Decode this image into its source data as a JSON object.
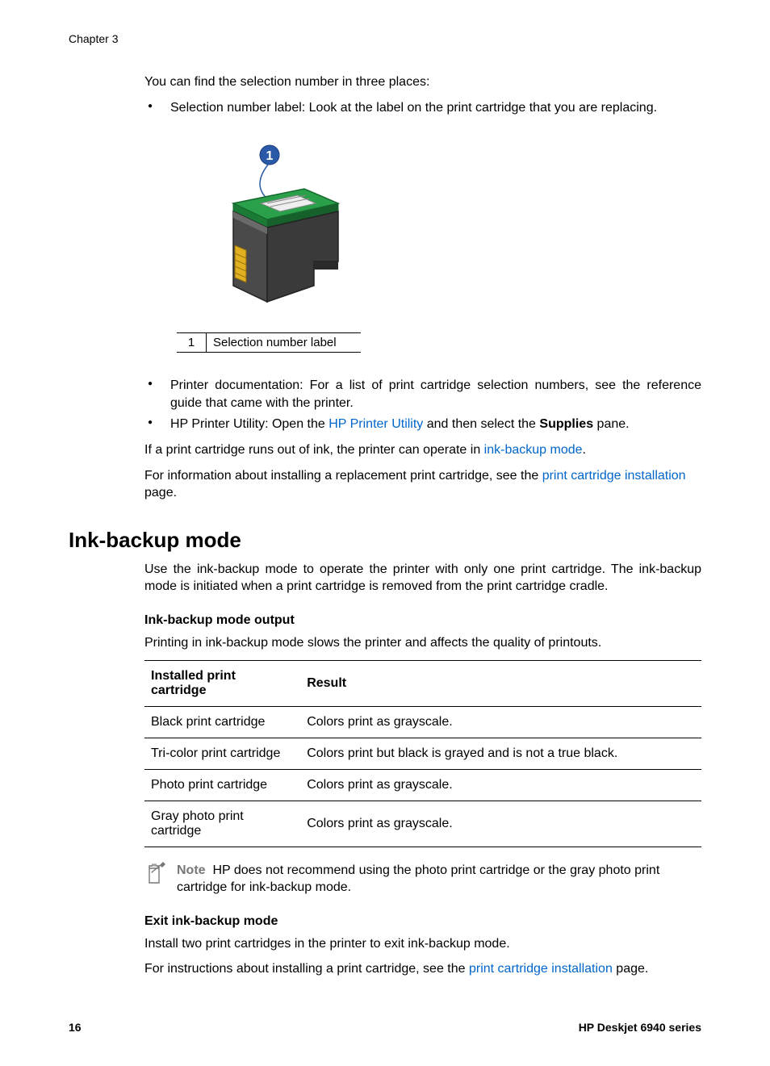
{
  "chapter": "Chapter 3",
  "intro": "You can find the selection number in three places:",
  "bullets_top": [
    "Selection number label: Look at the label on the print cartridge that you are replacing."
  ],
  "figure": {
    "num": "1",
    "caption": "Selection number label"
  },
  "bullets_mid": {
    "b1": "Printer documentation: For a list of print cartridge selection numbers, see the reference guide that came with the printer.",
    "b2_prefix": "HP Printer Utility: Open the ",
    "b2_link": "HP Printer Utility",
    "b2_mid": " and then select the ",
    "b2_bold": "Supplies",
    "b2_suffix": " pane."
  },
  "p_ink1_a": "If a print cartridge runs out of ink, the printer can operate in ",
  "p_ink1_link": "ink-backup mode",
  "p_ink1_b": ".",
  "p_ink2_a": "For information about installing a replacement print cartridge, see the ",
  "p_ink2_link": "print cartridge installation",
  "p_ink2_b": " page.",
  "h1": "Ink-backup mode",
  "p_mode": "Use the ink-backup mode to operate the printer with only one print cartridge. The ink-backup mode is initiated when a print cartridge is removed from the print cartridge cradle.",
  "h3_output": "Ink-backup mode output",
  "p_output": "Printing in ink-backup mode slows the printer and affects the quality of printouts.",
  "table": {
    "head": [
      "Installed print cartridge",
      "Result"
    ],
    "rows": [
      [
        "Black print cartridge",
        "Colors print as grayscale."
      ],
      [
        "Tri-color print cartridge",
        "Colors print but black is grayed and is not a true black."
      ],
      [
        "Photo print cartridge",
        "Colors print as grayscale."
      ],
      [
        "Gray photo print cartridge",
        "Colors print as grayscale."
      ]
    ]
  },
  "note": {
    "label": "Note",
    "text": "HP does not recommend using the photo print cartridge or the gray photo print cartridge for ink-backup mode."
  },
  "h3_exit": "Exit ink-backup mode",
  "p_exit": "Install two print cartridges in the printer to exit ink-backup mode.",
  "p_exit2_a": "For instructions about installing a print cartridge, see the ",
  "p_exit2_link": "print cartridge installation",
  "p_exit2_b": " page.",
  "footer": {
    "page": "16",
    "product": "HP Deskjet 6940 series"
  }
}
